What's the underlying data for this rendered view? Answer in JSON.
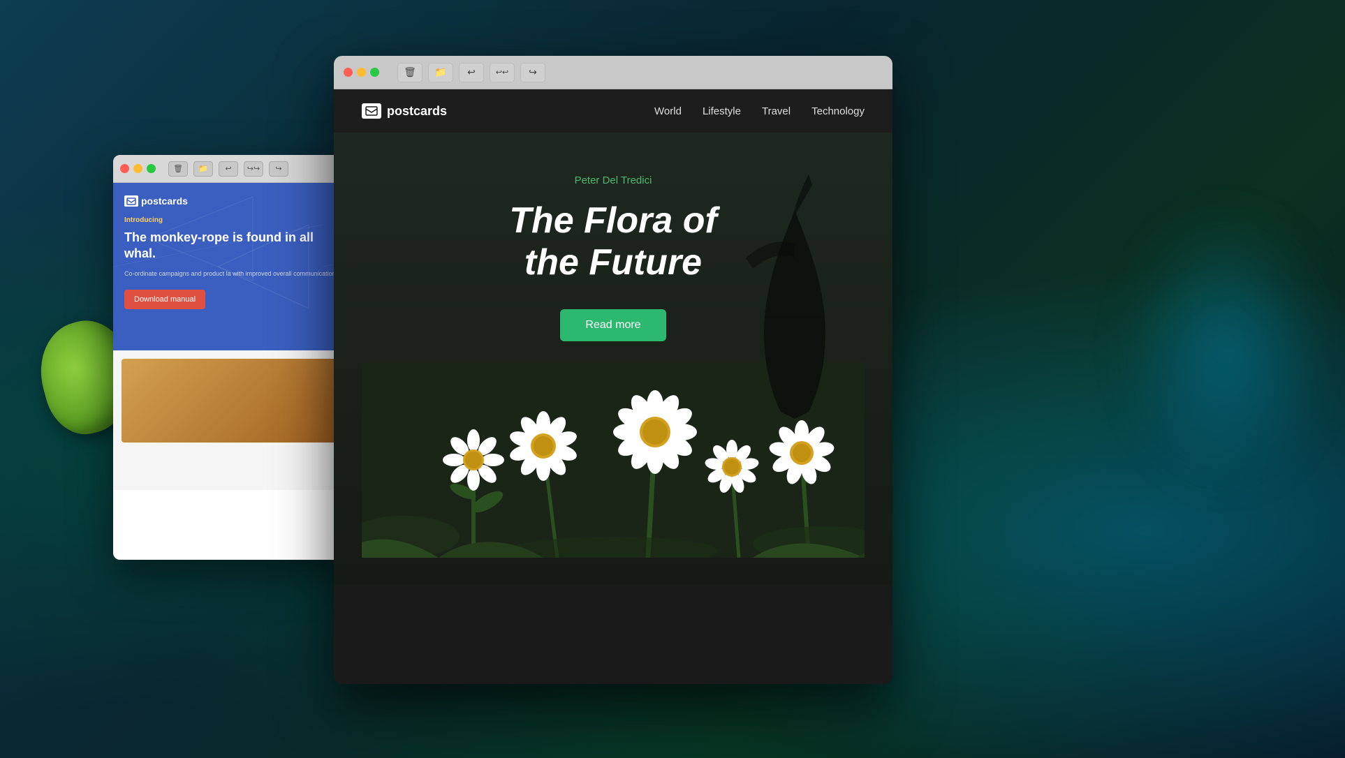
{
  "background": {
    "description": "Dark teal/green gradient desktop background"
  },
  "window_back": {
    "titlebar": {
      "traffic_lights": [
        "red",
        "yellow",
        "green"
      ],
      "buttons": [
        "trash",
        "folder",
        "back",
        "forward-all",
        "forward"
      ]
    },
    "email": {
      "logo": "postcards",
      "intro_label": "Introducing",
      "headline": "The monkey-rope is found in all whal.",
      "subtext": "Co-ordinate campaigns and product la with improved overall communication",
      "download_button": "Download manual"
    }
  },
  "window_front": {
    "titlebar": {
      "traffic_lights": [
        "red",
        "yellow",
        "green"
      ],
      "buttons": [
        "trash",
        "folder",
        "back",
        "forward-all",
        "forward"
      ]
    },
    "nav": {
      "logo": "postcards",
      "links": [
        "World",
        "Lifestyle",
        "Travel",
        "Technology"
      ]
    },
    "hero": {
      "author": "Peter Del Tredici",
      "title": "The Flora of the Future",
      "read_more_button": "Read more"
    }
  }
}
